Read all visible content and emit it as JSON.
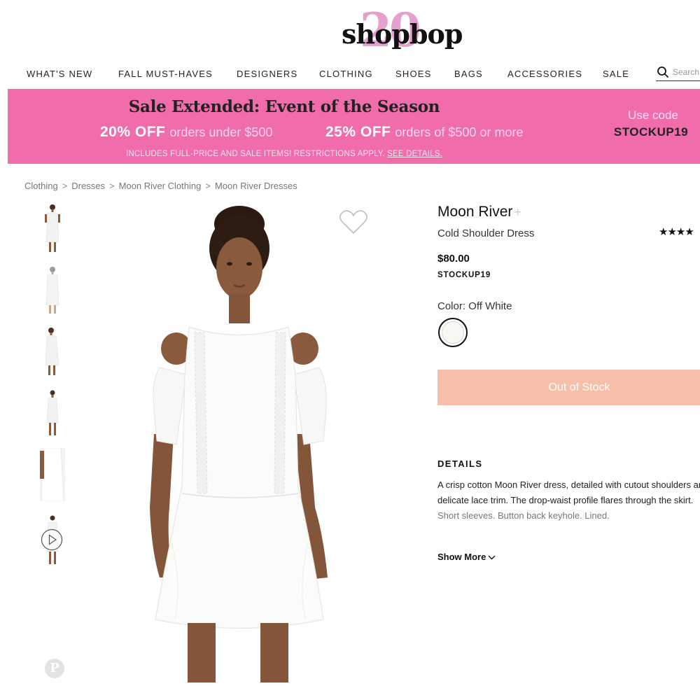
{
  "header": {
    "logo_text": "shopbop",
    "logo_badge": "20"
  },
  "nav": {
    "items": [
      "WHAT'S NEW",
      "FALL MUST-HAVES",
      "DESIGNERS",
      "CLOTHING",
      "SHOES",
      "BAGS",
      "ACCESSORIES",
      "SALE"
    ],
    "search_placeholder": "Search"
  },
  "banner": {
    "title": "Sale Extended: Event of the Season",
    "offer1_bold": "20% OFF",
    "offer1_text": "orders under $500",
    "offer2_bold": "25% OFF",
    "offer2_text": "orders of $500 or more",
    "fine_print": "INCLUDES FULL-PRICE AND SALE ITEMS! RESTRICTIONS APPLY.",
    "details_link": "SEE DETAILS.",
    "use_code_label": "Use code",
    "promo_code": "STOCKUP19",
    "background_color": "#f06cab"
  },
  "breadcrumb": [
    "Clothing",
    "Dresses",
    "Moon River Clothing",
    "Moon River Dresses"
  ],
  "product": {
    "brand": "Moon River",
    "brand_plus": "+",
    "name": "Cold Shoulder Dress",
    "rating_stars": "★★★★",
    "price": "$80.00",
    "price_code": "STOCKUP19",
    "color_label": "Color: Off White",
    "button_label": "Out of Stock",
    "button_color": "#f7bfa9"
  },
  "details": {
    "heading": "DETAILS",
    "lines": [
      "A crisp cotton Moon River dress, detailed with cutout shoulders and",
      "delicate lace trim. The drop-waist profile flares through the skirt.",
      "Short sleeves. Button back keyhole. Lined."
    ],
    "show_more": "Show More"
  },
  "social": {
    "pinterest_glyph": "P"
  }
}
